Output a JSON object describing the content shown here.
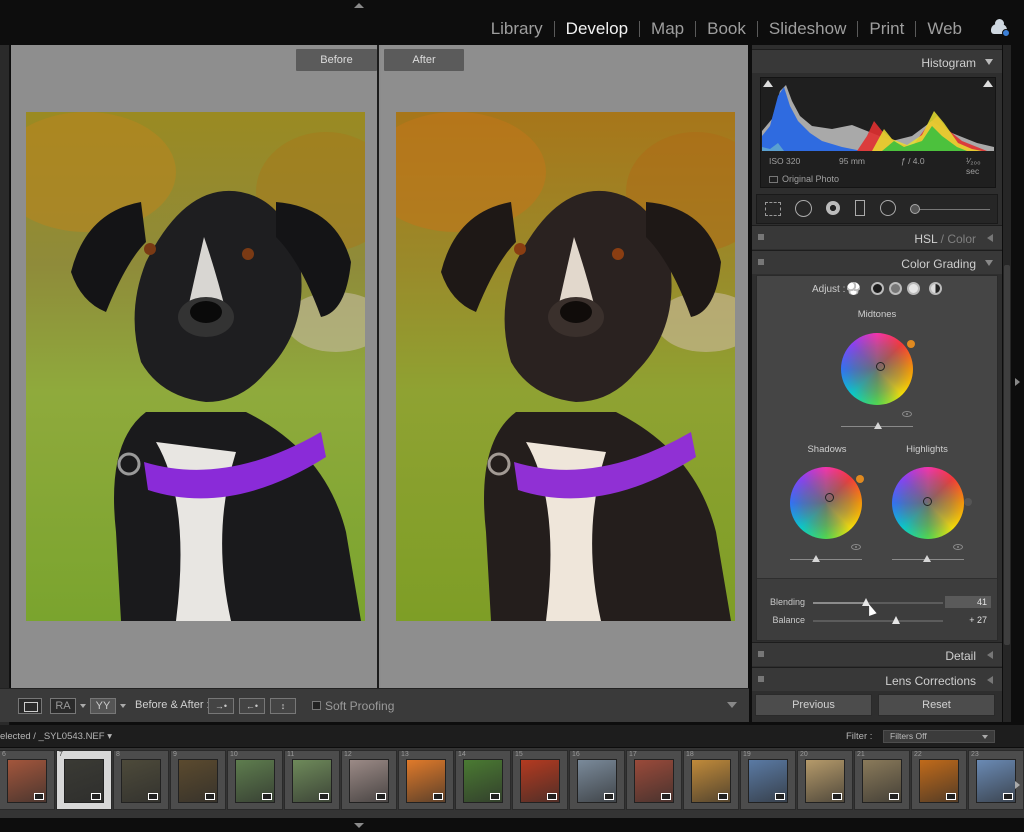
{
  "top_nav": {
    "modules": [
      "Library",
      "Develop",
      "Map",
      "Book",
      "Slideshow",
      "Print",
      "Web"
    ],
    "active_module": "Develop",
    "cloud_icon": "cloud-sync-icon"
  },
  "compare_view": {
    "before_label": "Before",
    "after_label": "After"
  },
  "toolbar": {
    "ra_label": "RA",
    "yy_label": "YY",
    "before_after_label": "Before & After :",
    "swap_buttons": [
      "→•",
      "←•",
      "↕"
    ],
    "soft_proofing_label": "Soft Proofing"
  },
  "histogram": {
    "title": "Histogram",
    "iso": "ISO 320",
    "focal_length": "95 mm",
    "aperture": "ƒ / 4.0",
    "shutter": "¹⁄₂₀₀ sec",
    "original_photo_label": "Original Photo"
  },
  "panels": {
    "hsl_title": "HSL",
    "color_title": "Color",
    "color_grading_title": "Color Grading",
    "detail_title": "Detail",
    "lens_corrections_title": "Lens Corrections"
  },
  "color_grading": {
    "adjust_label": "Adjust :",
    "midtones_label": "Midtones",
    "shadows_label": "Shadows",
    "highlights_label": "Highlights",
    "blending_label": "Blending",
    "blending_value": "41",
    "blending_level": 41,
    "balance_label": "Balance",
    "balance_value": "+ 27",
    "balance_level": 27
  },
  "buttons": {
    "previous": "Previous",
    "reset": "Reset"
  },
  "filmstrip": {
    "path_label": "elected / _SYL0543.NEF",
    "filter_label": "Filter :",
    "filter_value": "Filters Off",
    "items": [
      {
        "num": "6",
        "color": "#a3563c"
      },
      {
        "num": "7",
        "color": "#3a3a34",
        "selected": true
      },
      {
        "num": "8",
        "color": "#4d4a3a"
      },
      {
        "num": "9",
        "color": "#5b4a2e"
      },
      {
        "num": "10",
        "color": "#5e7d4e"
      },
      {
        "num": "11",
        "color": "#6e8a5a"
      },
      {
        "num": "12",
        "color": "#9b8a86"
      },
      {
        "num": "13",
        "color": "#e07a2a"
      },
      {
        "num": "14",
        "color": "#4a7a32"
      },
      {
        "num": "15",
        "color": "#b43a20"
      },
      {
        "num": "16",
        "color": "#7a8a9a"
      },
      {
        "num": "17",
        "color": "#9a4a3a"
      },
      {
        "num": "18",
        "color": "#c08a3a"
      },
      {
        "num": "19",
        "color": "#5a7aa4"
      },
      {
        "num": "20",
        "color": "#b59a6a"
      },
      {
        "num": "21",
        "color": "#8a7a5a"
      },
      {
        "num": "22",
        "color": "#c06a1a"
      },
      {
        "num": "23",
        "color": "#6a8ab4"
      }
    ]
  }
}
